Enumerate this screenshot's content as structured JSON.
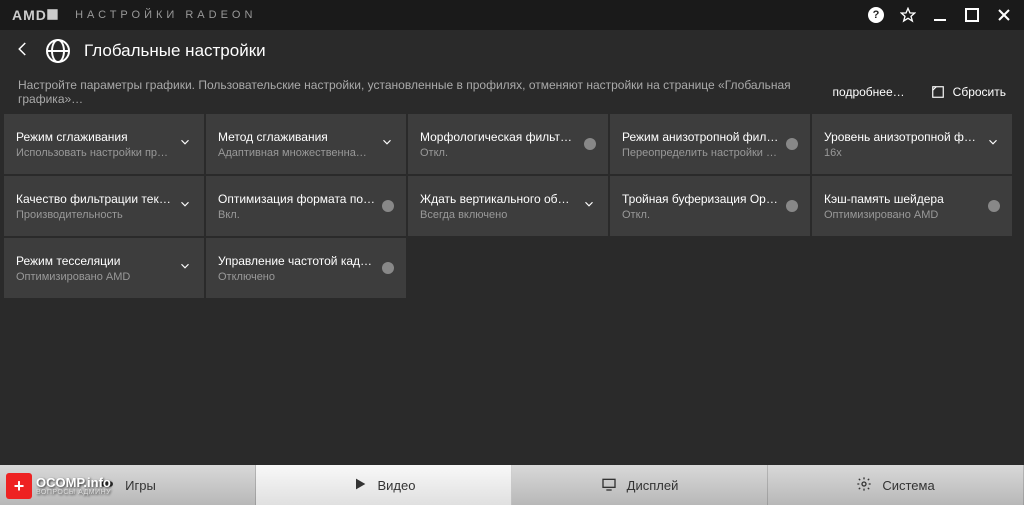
{
  "app": {
    "brand": "AMD⯀",
    "title": "НАСТРОЙКИ RADEON"
  },
  "header": {
    "title": "Глобальные настройки"
  },
  "info": {
    "text": "Настройте параметры графики. Пользовательские настройки, установленные в профилях, отменяют настройки на странице «Глобальная графика»…",
    "more": "подробнее…",
    "reset": "Сбросить"
  },
  "cards": [
    {
      "title": "Режим сглаживания",
      "value": "Использовать настройки пр…",
      "control": "chevron"
    },
    {
      "title": "Метод сглаживания",
      "value": "Адаптивная множественна…",
      "control": "chevron"
    },
    {
      "title": "Морфологическая фильтра…",
      "value": "Откл.",
      "control": "toggle"
    },
    {
      "title": "Режим анизотропной фильт…",
      "value": "Переопределить настройки …",
      "control": "toggle"
    },
    {
      "title": "Уровень анизотропной фил…",
      "value": "16x",
      "control": "chevron"
    },
    {
      "title": "Качество фильтрации текстур",
      "value": "Производительность",
      "control": "chevron"
    },
    {
      "title": "Оптимизация формата пове…",
      "value": "Вкл.",
      "control": "toggle"
    },
    {
      "title": "Ждать вертикального обно…",
      "value": "Всегда включено",
      "control": "chevron"
    },
    {
      "title": "Тройная буферизация Open…",
      "value": "Откл.",
      "control": "toggle"
    },
    {
      "title": "Кэш-память шейдера",
      "value": "Оптимизировано AMD",
      "control": "toggle"
    },
    {
      "title": "Режим тесселяции",
      "value": "Оптимизировано AMD",
      "control": "chevron"
    },
    {
      "title": "Управление частотой кадров",
      "value": "Отключено",
      "control": "toggle"
    }
  ],
  "tabs": [
    {
      "label": "Игры",
      "icon": "gamepad"
    },
    {
      "label": "Видео",
      "icon": "play",
      "active": true
    },
    {
      "label": "Дисплей",
      "icon": "display"
    },
    {
      "label": "Система",
      "icon": "gear"
    }
  ],
  "watermark": {
    "badge": "+",
    "main": "OCOMP.info",
    "sub": "ВОПРОСЫ АДМИНУ"
  }
}
